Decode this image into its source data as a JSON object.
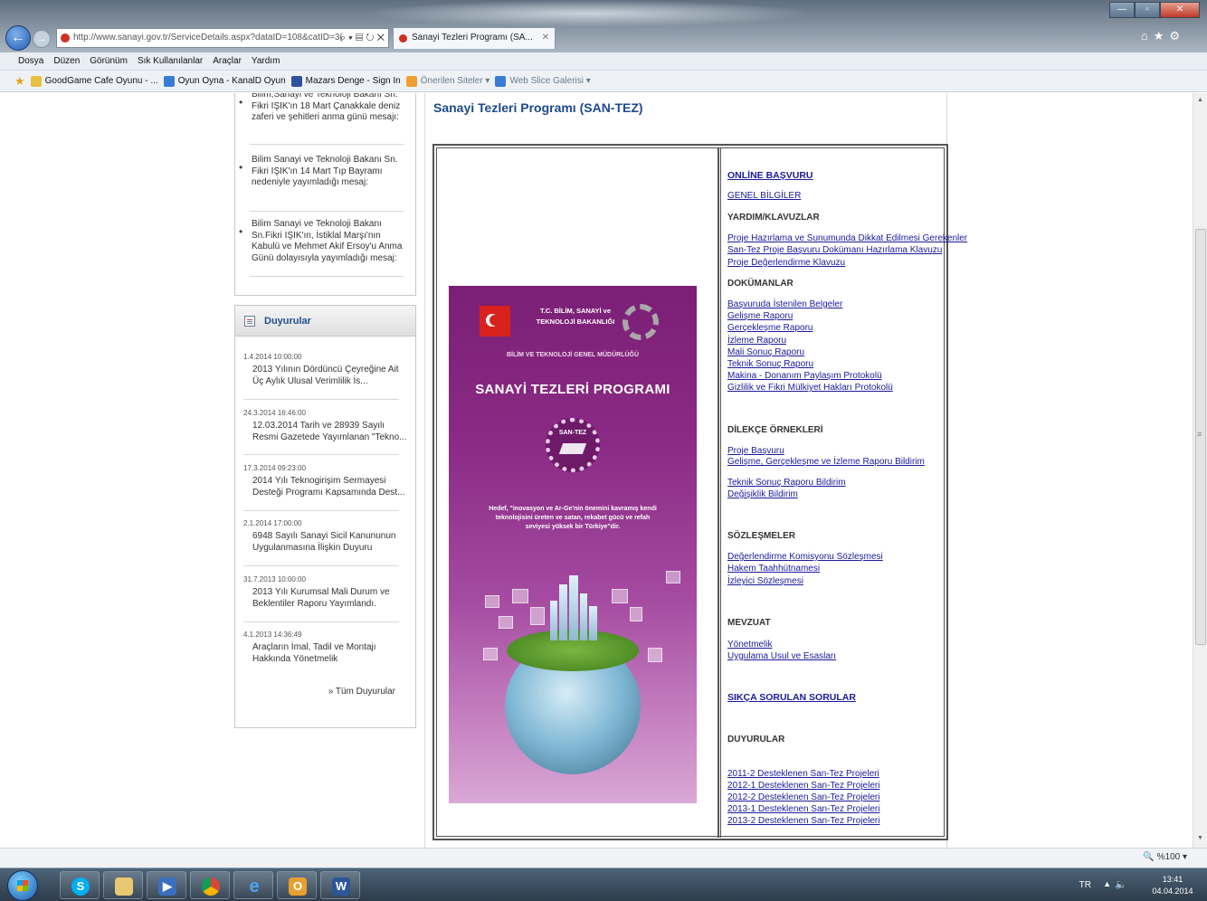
{
  "browser": {
    "address": "http://www.sanayi.gov.tr/ServiceDetails.aspx?dataID=108&catID=3(",
    "tab_title": "Sanayi Tezleri Programı (SA...",
    "menu": [
      "Dosya",
      "Düzen",
      "Görünüm",
      "Sık Kullanılanlar",
      "Araçlar",
      "Yardım"
    ],
    "favorites": [
      "GoodGame Cafe Oyunu - ...",
      "Oyun Oyna - KanalD Oyun",
      "Mazars Denge - Sign In",
      "Önerilen Siteler ▾",
      "Web Slice Galerisi ▾"
    ],
    "zoom": "%100"
  },
  "news": [
    "Bilim,Sanayi ve Teknoloji Bakanı Sn. Fikri IŞIK'ın 18 Mart Çanakkale deniz zaferi ve şehitleri anma günü mesajı:",
    "Bilim Sanayi ve Teknoloji Bakanı Sn. Fikri IŞIK'ın 14 Mart Tıp Bayramı nedeniyle yayımladığı mesaj:",
    "Bilim Sanayi ve Teknoloji Bakanı Sn.Fikri IŞIK'ın, İstiklal Marşı'nın Kabulü ve Mehmet Akif Ersoy'u Anma Günü dolayısıyla yayımladığı mesaj:"
  ],
  "duyurular": {
    "title": "Duyurular",
    "all_link": "» Tüm Duyurular",
    "items": [
      {
        "date": "1.4.2014 10:00:00",
        "text": "2013 Yılının Dördüncü Çeyreğine Ait Üç Aylık Ulusal Verimlilik İs..."
      },
      {
        "date": "24.3.2014 16:46:00",
        "text": "12.03.2014 Tarih ve 28939 Sayılı Resmi Gazetede Yayımlanan \"Tekno..."
      },
      {
        "date": "17.3.2014 09:23:00",
        "text": "2014 Yılı Teknogirişim Sermayesi Desteği Programı Kapsamında Dest..."
      },
      {
        "date": "2.1.2014 17:00:00",
        "text": "6948 Sayılı Sanayi Sicil Kanununun Uygulanmasına İlişkin Duyuru"
      },
      {
        "date": "31.7.2013 10:00:00",
        "text": "2013 Yılı Kurumsal Mali Durum ve Beklentiler Raporu Yayımlandı."
      },
      {
        "date": "4.1.2013 14:36:49",
        "text": "Araçların İmal, Tadil ve Montajı Hakkında Yönetmelik"
      }
    ]
  },
  "main": {
    "title": "Sanayi Tezleri Programı (SAN-TEZ)",
    "poster": {
      "ministry": "T.C. BİLİM, SANAYİ ve TEKNOLOJİ BAKANLIĞI",
      "gmd": "BİLİM VE TEKNOLOJİ GENEL MÜDÜRLÜĞÜ",
      "title": "SANAYİ TEZLERİ PROGRAMI",
      "seal": "SAN-TEZ",
      "slogan": "Hedef, \"inovasyon ve Ar-Ge'nin önemini kavramış kendi teknolojisini üreten ve satan, rekabet gücü ve refah seviyesi yüksek bir Türkiye\"dir."
    },
    "links": {
      "online": "ONLİNE BAŞVURU",
      "genel": "GENEL BİLGİLER",
      "yardim_head": "YARDIM/KLAVUZLAR",
      "yardim": [
        "Proje Hazırlama ve Sunumunda Dikkat Edilmesi Gerekenler",
        "San-Tez Proje Başvuru Dokümanı Hazırlama Klavuzu",
        "Proje Değerlendirme Klavuzu"
      ],
      "dok_head": "DOKÜMANLAR",
      "dok": [
        "Başvuruda İstenilen Belgeler",
        "Gelişme Raporu",
        "Gerçekleşme Raporu",
        "İzleme Raporu",
        "Mali Sonuç Raporu",
        "Teknik Sonuç Raporu",
        "Makina - Donanım Paylaşım Protokolü",
        "Gizlilik ve Fikri Mülkiyet Hakları Protokolü"
      ],
      "dil_head": "DİLEKÇE ÖRNEKLERİ",
      "dil": [
        "Proje Başvuru",
        "Gelişme, Gerçekleşme ve İzleme Raporu Bildirim",
        "Teknik Sonuç Raporu Bildirim",
        "Değişiklik Bildirim"
      ],
      "soz_head": "SÖZLEŞMELER",
      "soz": [
        "Değerlendirme Komisyonu Sözleşmesi",
        "Hakem Taahhütnamesi",
        "İzleyici Sözleşmesi"
      ],
      "mev_head": "MEVZUAT",
      "mev": [
        "Yönetmelik",
        "Uygulama Usul ve Esasları"
      ],
      "sss": "SIKÇA SORULAN SORULAR",
      "duy_head": "DUYURULAR",
      "duy": [
        "2011-2 Desteklenen San-Tez Projeleri",
        "2012-1 Desteklenen San-Tez Projeleri",
        "2012-2 Desteklenen San-Tez Projeleri",
        "2013-1 Desteklenen San-Tez Projeleri",
        "2013-2 Desteklenen San-Tez Projeleri"
      ]
    }
  },
  "taskbar": {
    "lang": "TR",
    "time": "13:41",
    "date": "04.04.2014"
  }
}
